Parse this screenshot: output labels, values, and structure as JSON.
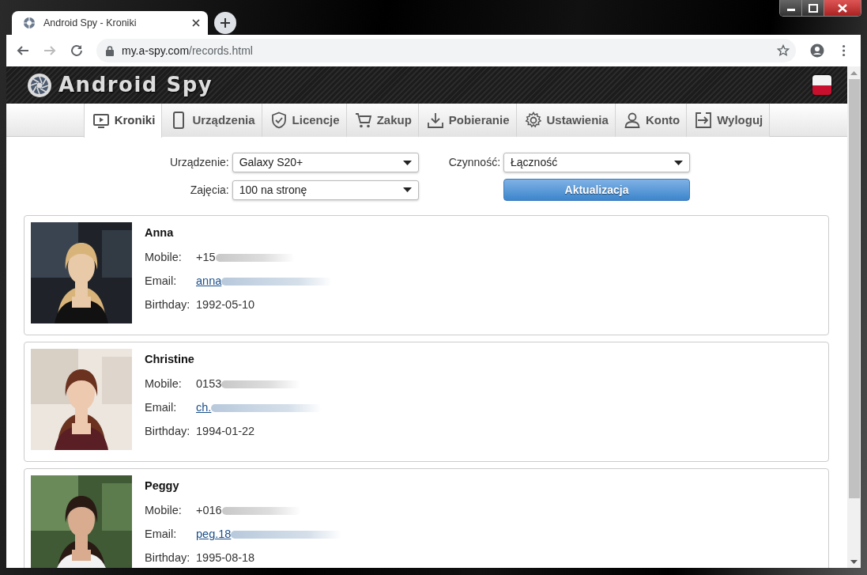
{
  "browser": {
    "tab_title": "Android Spy - Kroniki",
    "url_host": "my.a-spy.com",
    "url_path": "/records.html"
  },
  "header": {
    "logo_text": "Android Spy"
  },
  "nav": [
    {
      "label": "Kroniki",
      "selected": true
    },
    {
      "label": "Urządzenia",
      "selected": false
    },
    {
      "label": "Licencje",
      "selected": false
    },
    {
      "label": "Zakup",
      "selected": false
    },
    {
      "label": "Pobieranie",
      "selected": false
    },
    {
      "label": "Ustawienia",
      "selected": false
    },
    {
      "label": "Konto",
      "selected": false
    },
    {
      "label": "Wyloguj",
      "selected": false
    }
  ],
  "filters": [
    {
      "label": "Urządzenie:",
      "value": "Galaxy S20+"
    },
    {
      "label": "Czynność:",
      "value": "Łączność"
    },
    {
      "label": "Zajęcia:",
      "value": "100 na stronę"
    }
  ],
  "update_button": "Aktualizacja",
  "contacts": [
    {
      "name": "Anna",
      "fields": [
        {
          "label": "Mobile:",
          "value": "+15",
          "kind": "text",
          "redacted": true
        },
        {
          "label": "Email:",
          "value": "anna",
          "kind": "link",
          "redacted": true
        },
        {
          "label": "Birthday:",
          "value": "1992-05-10",
          "kind": "text"
        }
      ]
    },
    {
      "name": "Christine",
      "fields": [
        {
          "label": "Mobile:",
          "value": "0153",
          "kind": "text",
          "redacted": true
        },
        {
          "label": "Email:",
          "value": "ch.",
          "kind": "link",
          "redacted": true
        },
        {
          "label": "Birthday:",
          "value": "1994-01-22",
          "kind": "text"
        }
      ]
    },
    {
      "name": "Peggy",
      "fields": [
        {
          "label": "Mobile:",
          "value": "+016",
          "kind": "text",
          "redacted": true
        },
        {
          "label": "Email:",
          "value": "peg.18",
          "kind": "link",
          "redacted": true
        },
        {
          "label": "Birthday:",
          "value": "1995-08-18",
          "kind": "text"
        }
      ]
    }
  ]
}
